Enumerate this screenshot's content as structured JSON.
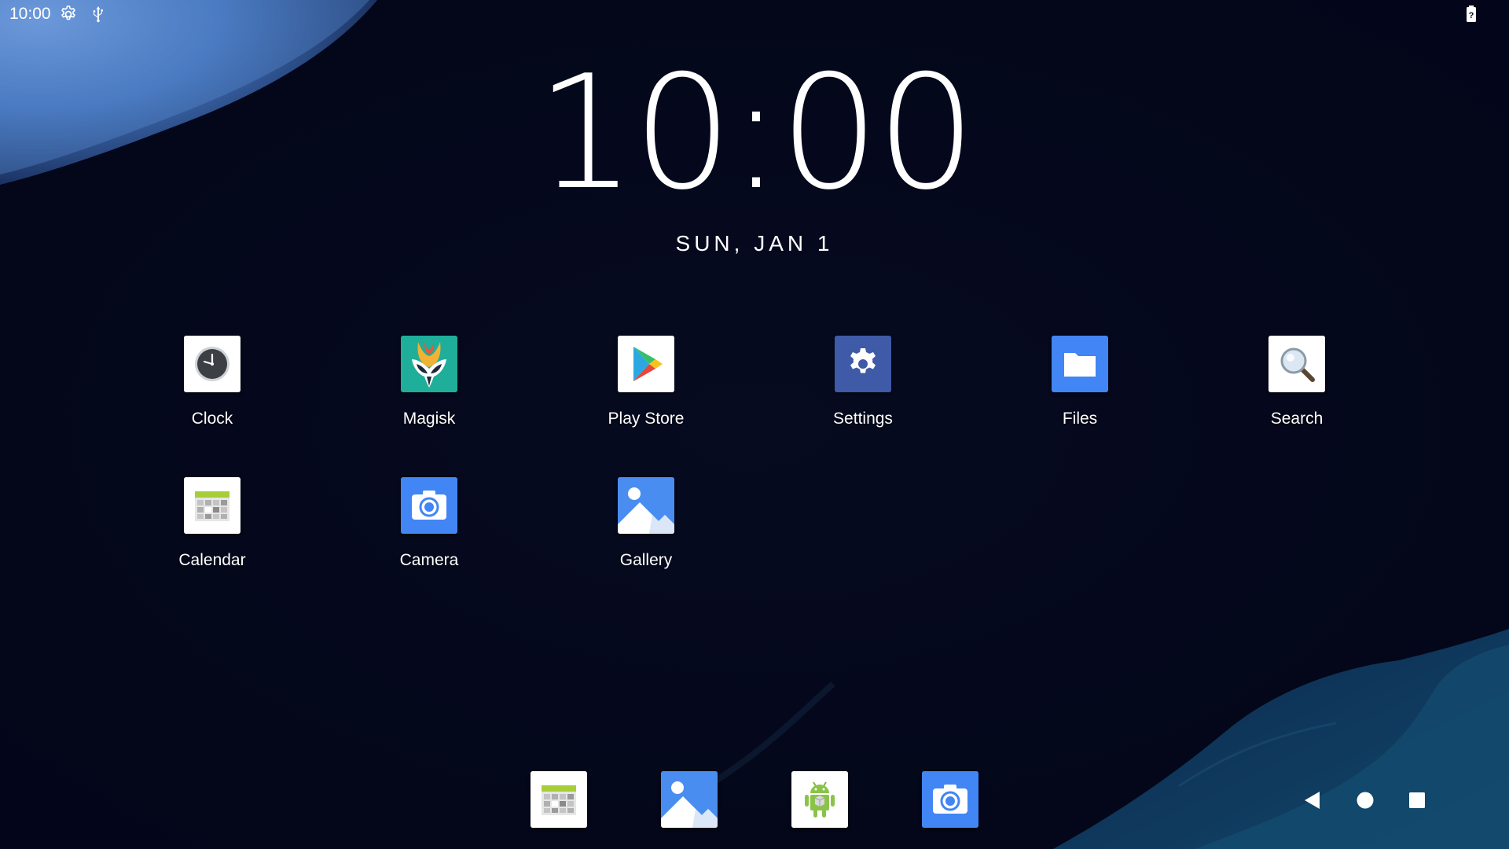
{
  "status_bar": {
    "time": "10:00",
    "icons": [
      "gear-icon",
      "usb-icon"
    ],
    "battery_icon": "battery-unknown-icon"
  },
  "clock_widget": {
    "time": "10:00",
    "date": "SUN, JAN 1"
  },
  "apps": [
    {
      "label": "Clock",
      "icon": "clock-icon"
    },
    {
      "label": "Magisk",
      "icon": "magisk-icon"
    },
    {
      "label": "Play Store",
      "icon": "play-store-icon"
    },
    {
      "label": "Settings",
      "icon": "settings-icon"
    },
    {
      "label": "Files",
      "icon": "folder-icon"
    },
    {
      "label": "Search",
      "icon": "magnifier-icon"
    },
    {
      "label": "Calendar",
      "icon": "calendar-icon"
    },
    {
      "label": "Camera",
      "icon": "camera-icon"
    },
    {
      "label": "Gallery",
      "icon": "gallery-icon"
    }
  ],
  "dock": [
    {
      "icon": "calendar-icon"
    },
    {
      "icon": "gallery-icon"
    },
    {
      "icon": "android-package-icon"
    },
    {
      "icon": "camera-icon"
    }
  ],
  "nav_bar": [
    "back-icon",
    "home-icon",
    "recents-icon"
  ],
  "colors": {
    "background": "#05081a",
    "wallpaper_accent": "#3f6fb3",
    "settings_tile": "#3f5aa6",
    "files_tile": "#4285f4",
    "camera_tile": "#4285f4",
    "magisk_tile": "#1fae99",
    "gallery_tile": "#4a8df0"
  }
}
